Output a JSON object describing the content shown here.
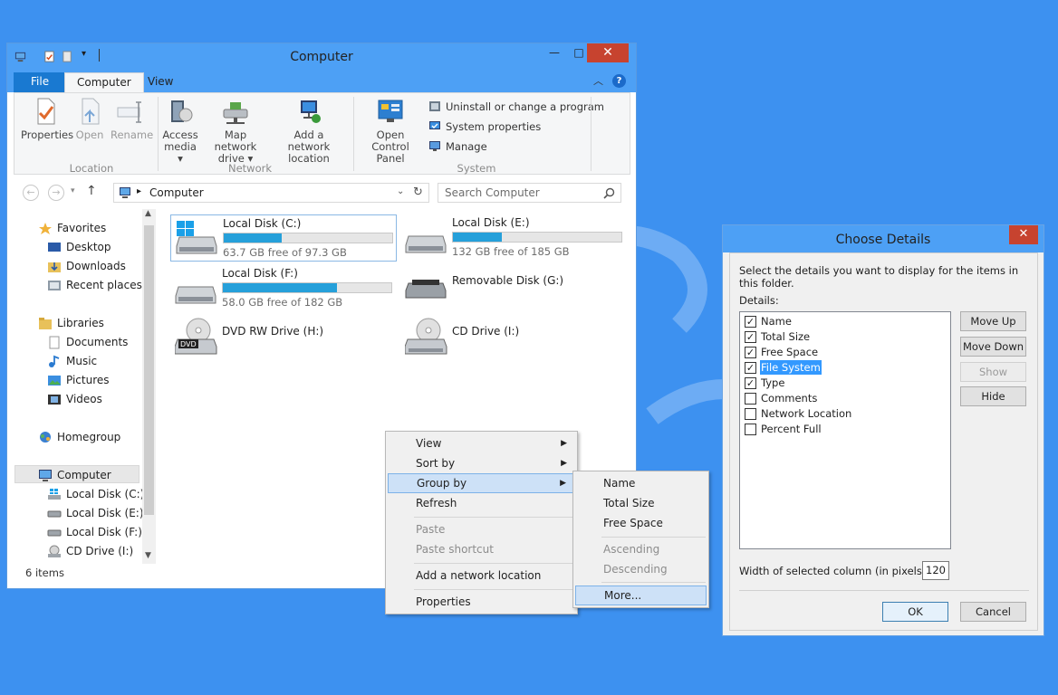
{
  "explorer": {
    "window_title": "Computer",
    "window_buttons": {
      "minimize": "—",
      "maximize": "□",
      "close": "✕"
    },
    "tabs": {
      "file": "File",
      "computer": "Computer",
      "view": "View"
    },
    "ribbon": {
      "location": {
        "properties": "Properties",
        "open": "Open",
        "rename": "Rename",
        "label": "Location"
      },
      "network": {
        "access_media": "Access",
        "access_media_2": "media ▾",
        "map_drive": "Map network",
        "map_drive_2": "drive ▾",
        "add_location": "Add a network",
        "add_location_2": "location",
        "label": "Network"
      },
      "system": {
        "control_panel": "Open Control",
        "control_panel_2": "Panel",
        "uninstall": "Uninstall or change a program",
        "sys_props": "System properties",
        "manage": "Manage",
        "label": "System"
      }
    },
    "address": {
      "path": "Computer",
      "search_placeholder": "Search Computer"
    },
    "nav": {
      "favorites": "Favorites",
      "desktop": "Desktop",
      "downloads": "Downloads",
      "recent": "Recent places",
      "libraries": "Libraries",
      "documents": "Documents",
      "music": "Music",
      "pictures": "Pictures",
      "videos": "Videos",
      "homegroup": "Homegroup",
      "computer": "Computer",
      "disk_c": "Local Disk (C:)",
      "disk_e": "Local Disk (E:)",
      "disk_f": "Local Disk (F:)",
      "disk_i": "CD Drive (I:)"
    },
    "drives": [
      {
        "name": "Local Disk (C:)",
        "size": "63.7 GB free of 97.3 GB",
        "used_fraction": 0.345
      },
      {
        "name": "Local Disk (E:)",
        "size": "132 GB free of 185 GB",
        "used_fraction": 0.29
      },
      {
        "name": "Local Disk (F:)",
        "size": "58.0 GB free of 182 GB",
        "used_fraction": 0.68
      },
      {
        "name": "Removable Disk (G:)"
      },
      {
        "name": "DVD RW Drive (H:)"
      },
      {
        "name": "CD Drive (I:)"
      }
    ],
    "status": "6 items"
  },
  "context_menu": {
    "view": "View",
    "sort_by": "Sort by",
    "group_by": "Group by",
    "refresh": "Refresh",
    "paste": "Paste",
    "paste_shortcut": "Paste shortcut",
    "add_network_location": "Add a network location",
    "properties": "Properties"
  },
  "submenu": {
    "name": "Name",
    "total_size": "Total Size",
    "free_space": "Free Space",
    "ascending": "Ascending",
    "descending": "Descending",
    "more": "More..."
  },
  "dialog": {
    "title": "Choose Details",
    "instruction": "Select the details you want to display for the items in this folder.",
    "details_label": "Details:",
    "items": [
      {
        "label": "Name",
        "checked": "✓"
      },
      {
        "label": "Total Size",
        "checked": "✓"
      },
      {
        "label": "Free Space",
        "checked": "✓"
      },
      {
        "label": "File System",
        "checked": "✓"
      },
      {
        "label": "Type",
        "checked": "✓"
      },
      {
        "label": "Comments",
        "checked": ""
      },
      {
        "label": "Network Location",
        "checked": ""
      },
      {
        "label": "Percent Full",
        "checked": ""
      }
    ],
    "buttons": {
      "move_up": "Move Up",
      "move_down": "Move Down",
      "show": "Show",
      "hide": "Hide",
      "ok": "OK",
      "cancel": "Cancel"
    },
    "width_label": "Width of selected column (in pixels):",
    "width_value": "120",
    "close": "✕"
  }
}
